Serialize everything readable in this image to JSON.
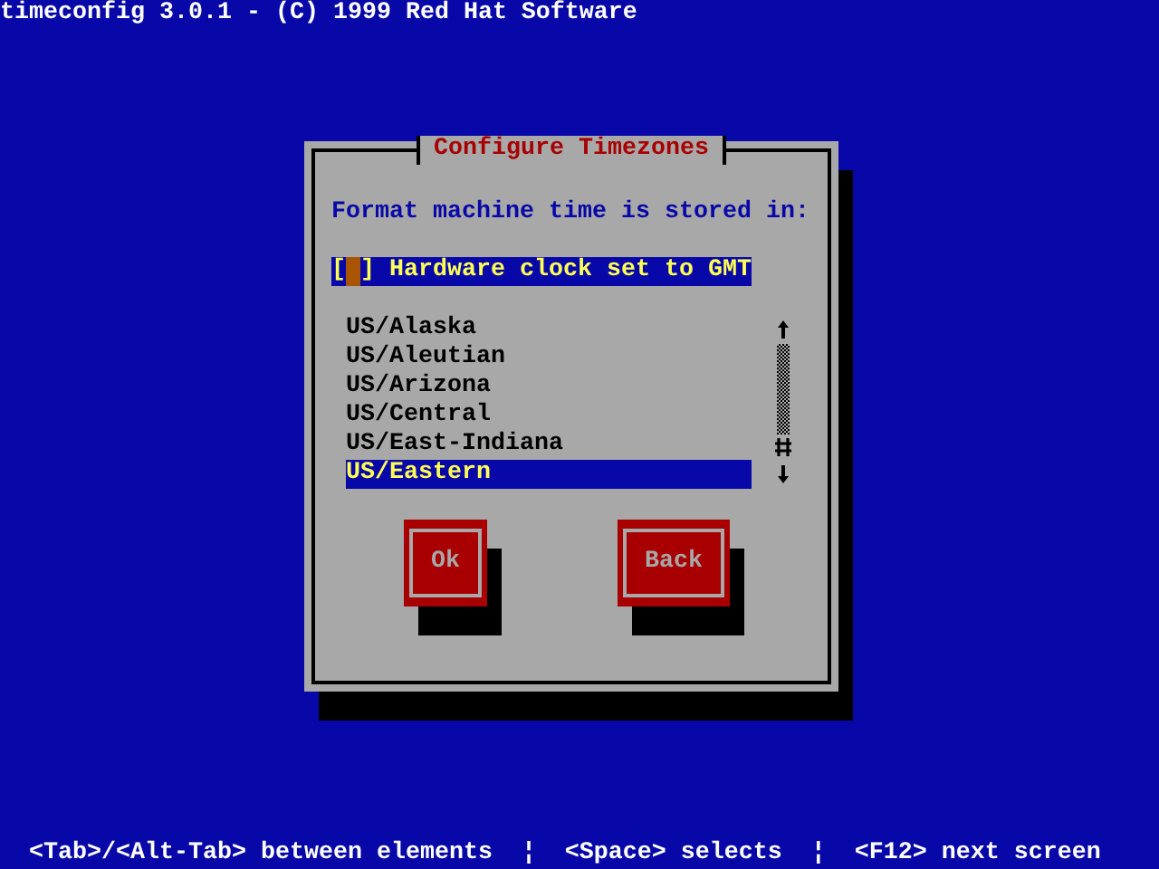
{
  "window": {
    "title": "timeconfig 3.0.1 - (C) 1999 Red Hat Software"
  },
  "dialog": {
    "title": "Configure Timezones",
    "prompt": "Format machine time is stored in:",
    "checkbox": {
      "open": "[",
      "close": "]",
      "label": "Hardware clock set to GMT",
      "checked": false,
      "focused": true
    },
    "timezones": [
      {
        "label": "US/Alaska",
        "selected": false
      },
      {
        "label": "US/Aleutian",
        "selected": false
      },
      {
        "label": "US/Arizona",
        "selected": false
      },
      {
        "label": "US/Central",
        "selected": false
      },
      {
        "label": "US/East-Indiana",
        "selected": false
      },
      {
        "label": "US/Eastern",
        "selected": true
      }
    ],
    "buttons": [
      {
        "label": "Ok"
      },
      {
        "label": "Back"
      }
    ]
  },
  "status_bar": {
    "text": "<Tab>/<Alt-Tab> between elements  ¦  <Space> selects  ¦  <F12> next screen"
  }
}
